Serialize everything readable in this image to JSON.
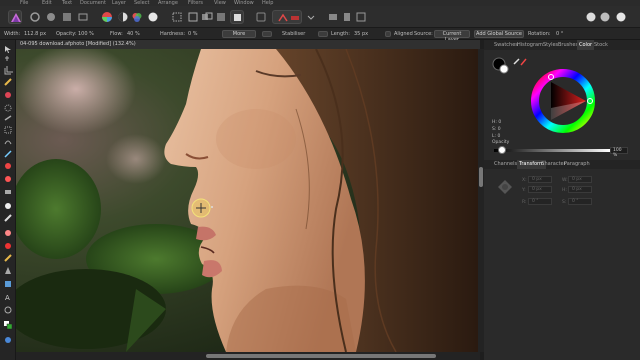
{
  "menu": [
    "File",
    "Edit",
    "Text",
    "Document",
    "Layer",
    "Select",
    "Arrange",
    "Filters",
    "View",
    "Window",
    "Help"
  ],
  "context_bar": {
    "width_label": "Width:",
    "width_value": "112.8 px",
    "opacity_label": "Opacity:",
    "opacity_value": "100 %",
    "flow_label": "Flow:",
    "flow_value": "40 %",
    "hardness_label": "Hardness:",
    "hardness_value": "0 %",
    "more_label": "More",
    "stabilizer_label": "Stabiliser",
    "length_label": "Length:",
    "length_value": "35 px",
    "aligned_label": "Aligned",
    "source_label": "Source:",
    "source_value": "Current Layer",
    "add_global_source_label": "Add Global Source",
    "rotation_label": "Rotation:",
    "rotation_value": "0 °"
  },
  "document": {
    "tab_title": "04-095 download.afphoto [Modified] (132.4%)"
  },
  "panel": {
    "tabs": [
      "Swatches",
      "Histogram",
      "Styles",
      "Brushes",
      "Color",
      "Stock"
    ],
    "active_tab": "Color",
    "hsl": [
      "H: 0",
      "S: 0",
      "L: 0"
    ],
    "opacity_label": "Opacity",
    "opacity_value": "100 %",
    "lower_tabs": [
      "Channels",
      "Transform",
      "Character",
      "Paragraph"
    ],
    "lower_active_tab": "Transform",
    "transform_fields": [
      "0 px",
      "0 px",
      "0 px",
      "0 px",
      "0 °",
      "0 °"
    ],
    "transform_labels": [
      "X:",
      "W:",
      "Y:",
      "H:",
      "R:",
      "S:"
    ]
  },
  "colors": {
    "accent": "#f0d94a",
    "panel_bg": "#2a2a2a",
    "toolbar_bg": "#2d2d2d"
  }
}
